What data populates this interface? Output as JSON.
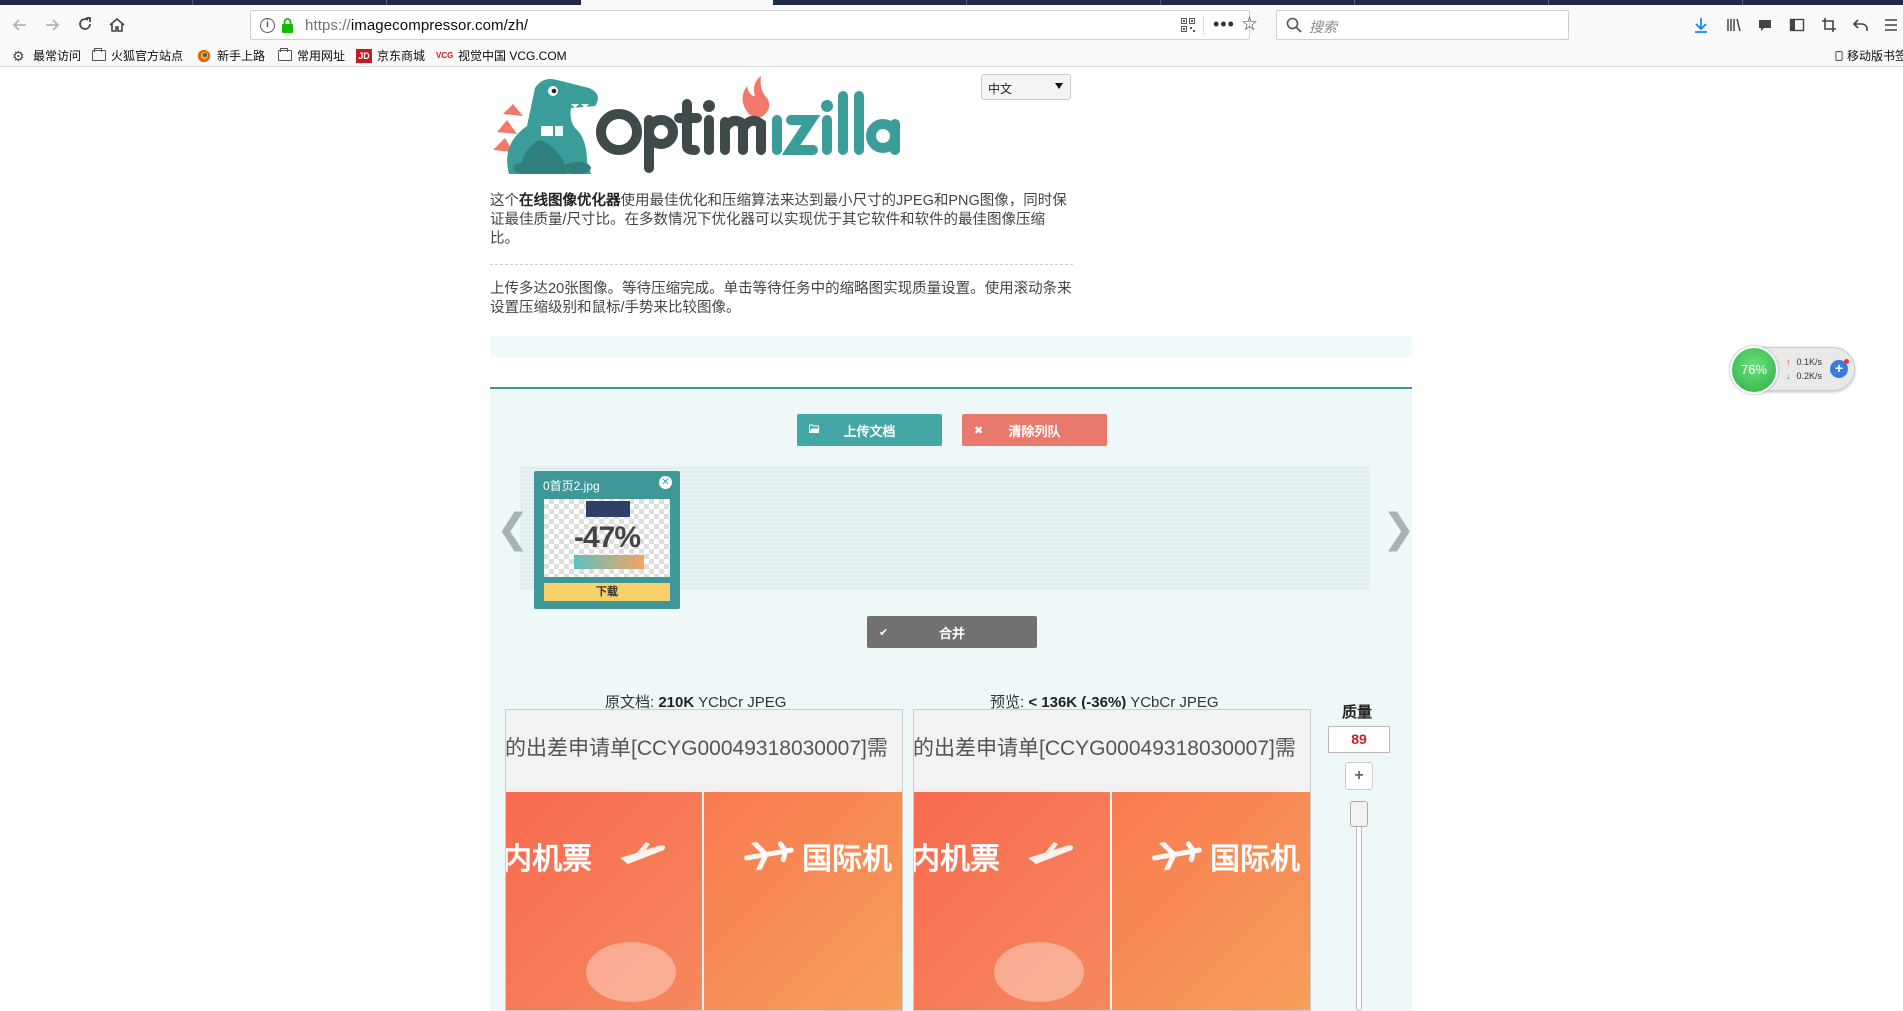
{
  "browser": {
    "url_scheme": "https://",
    "url_rest": "imagecompressor.com/zh/",
    "search_placeholder": "搜索",
    "more_glyph": "•••",
    "bookmarks": [
      {
        "label": "最常访问",
        "icon": "gear-icon"
      },
      {
        "label": "火狐官方站点",
        "icon": "folder-icon"
      },
      {
        "label": "新手上路",
        "icon": "firefox-icon"
      },
      {
        "label": "常用网址",
        "icon": "folder-icon"
      },
      {
        "label": "京东商城",
        "icon": "jd-icon"
      },
      {
        "label": "视觉中国 VCG.COM",
        "icon": "vcg-icon"
      }
    ],
    "mobile_bookmarks": "移动版书签",
    "jd_badge": "JD",
    "vcg_badge": "VCG"
  },
  "page": {
    "language": "中文",
    "intro_prefix": "这个",
    "intro_bold": "在线图像优化器",
    "intro_rest": "使用最佳优化和压缩算法来达到最小尺寸的JPEG和PNG图像，同时保证最佳质量/尺寸比。在多数情况下优化器可以实现优于其它软件和软件的最佳图像压缩比。",
    "instructions": "上传多达20张图像。等待压缩完成。单击等待任务中的缩略图实现质量设置。使用滚动条来设置压缩级别和鼠标/手势来比较图像。",
    "upload_label": "上传文档",
    "clear_label": "清除列队",
    "merge_label": "合并",
    "left_arrow": "❮",
    "right_arrow": "❯",
    "thumb": {
      "filename": "0首页2.jpg",
      "percent": "-47%",
      "download": "下载",
      "close": "✕"
    },
    "original_prefix": "原文档:",
    "original_size": "210K",
    "original_type": "YCbCr JPEG",
    "preview_prefix": "预览:",
    "preview_size": "< 136K (-36%)",
    "preview_type": "YCbCr JPEG",
    "quality_label": "质量",
    "quality_value": "89",
    "quality_plus": "+",
    "image_caption": "的出差申请单[CCYG00049318030007]需",
    "tile_left": "内机票",
    "tile_right": "国际机"
  },
  "netmon": {
    "percent": "76%",
    "up_glyph": "↑",
    "down_glyph": "↓",
    "up_speed": "0.1K/s",
    "down_speed": "0.2K/s",
    "plus": "+"
  },
  "colors": {
    "teal": "#45a7a5",
    "coral": "#e8796c",
    "grey_button": "#717171",
    "download_yellow": "#f7d06a"
  }
}
